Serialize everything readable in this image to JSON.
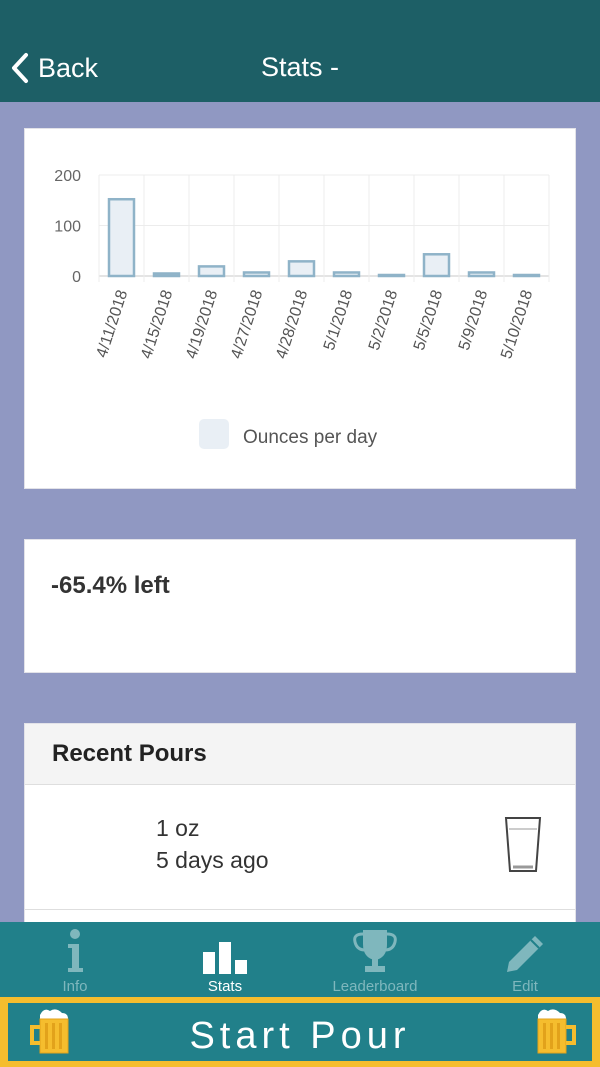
{
  "header": {
    "back_label": "Back",
    "title": "Stats -"
  },
  "chart_data": {
    "type": "bar",
    "categories": [
      "4/11/2018",
      "4/15/2018",
      "4/19/2018",
      "4/27/2018",
      "4/28/2018",
      "5/1/2018",
      "5/2/2018",
      "5/5/2018",
      "5/9/2018",
      "5/10/2018"
    ],
    "series": [
      {
        "name": "Ounces per day",
        "values": [
          152,
          5,
          19,
          7,
          29,
          7,
          2,
          43,
          7,
          2
        ]
      }
    ],
    "yticks": [
      "0",
      "100",
      "200"
    ],
    "ylim": [
      0,
      200
    ],
    "grid": true,
    "legend_position": "bottom",
    "colors": {
      "fill": "#e9eff5",
      "stroke": "#8fb3c8"
    }
  },
  "remaining": {
    "text": "-65.4% left"
  },
  "recent_pours": {
    "title": "Recent Pours",
    "items": [
      {
        "amount": "1 oz",
        "time": "5 days ago"
      }
    ]
  },
  "tabs": [
    {
      "label": "Info",
      "icon": "info-icon",
      "active": false
    },
    {
      "label": "Stats",
      "icon": "bar-chart-icon",
      "active": true
    },
    {
      "label": "Leaderboard",
      "icon": "trophy-icon",
      "active": false
    },
    {
      "label": "Edit",
      "icon": "pencil-icon",
      "active": false
    }
  ],
  "start_pour": {
    "label": "Start Pour"
  },
  "colors": {
    "header": "#1d5f66",
    "background": "#9098c2",
    "tabbar": "#21808a",
    "accent": "#f5bd2e"
  }
}
